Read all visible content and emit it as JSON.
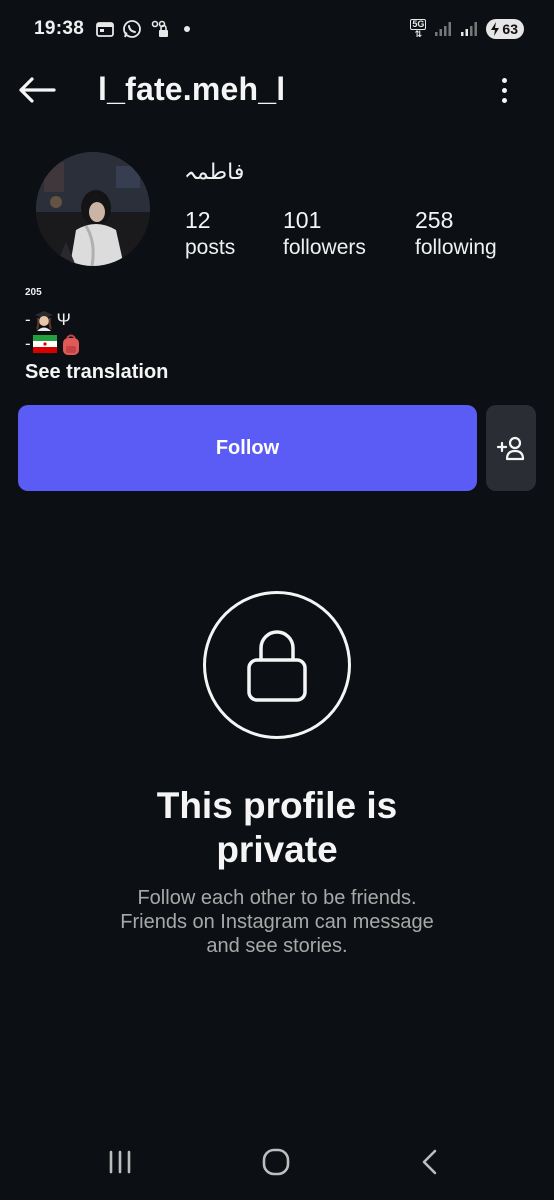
{
  "status_bar": {
    "time": "19:38",
    "network": "5G",
    "battery": "63"
  },
  "header": {
    "username": "l_fate.meh_l"
  },
  "profile": {
    "display_name": "فاطمہ",
    "posts_count": "12",
    "posts_label": "posts",
    "followers_count": "101",
    "followers_label": "followers",
    "following_count": "258",
    "following_label": "following",
    "bio_line1": "205",
    "bio_line2_prefix": "-",
    "bio_line2_suffix": "Ψ",
    "bio_line3_prefix": "-",
    "see_translation": "See translation"
  },
  "actions": {
    "follow_label": "Follow"
  },
  "private_notice": {
    "title_line1": "This profile is",
    "title_line2": "private",
    "desc_line1": "Follow each other to be friends.",
    "desc_line2": "Friends on Instagram can message",
    "desc_line3": "and see stories."
  },
  "colors": {
    "background": "#0c1014",
    "follow_button": "#5b5bf5",
    "secondary_button": "#2a2d33",
    "muted_text": "#a8a8a8"
  },
  "icons": {
    "back": "arrow-left-icon",
    "more": "more-vertical-icon",
    "suggest": "add-person-icon",
    "lock": "lock-icon",
    "nav_recent": "recent-apps-icon",
    "nav_home": "home-icon",
    "nav_back": "back-chevron-icon"
  }
}
